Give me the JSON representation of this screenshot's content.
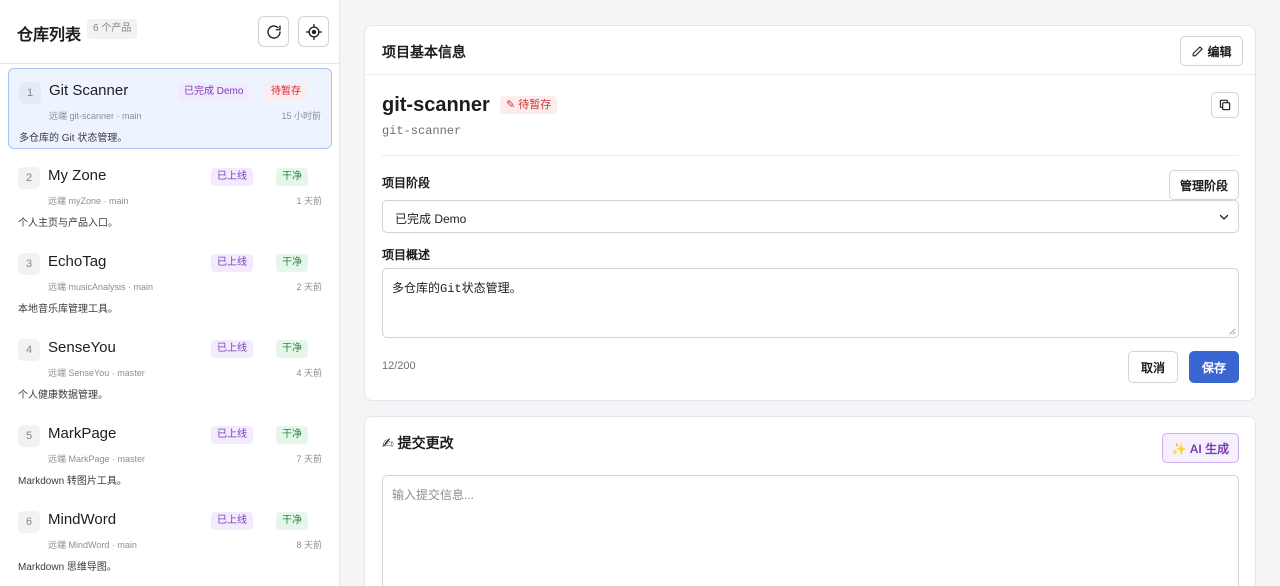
{
  "sidebar": {
    "title": "仓库列表",
    "count": "6 个产品",
    "repos": [
      {
        "index": "1",
        "name": "Git Scanner",
        "stage": "已完成 Demo",
        "status": "待暂存",
        "status_type": "pending",
        "meta": "远端 git-scanner ·   main",
        "time": "15 小时前",
        "desc": "多仓库的 Git 状态管理。",
        "active": true
      },
      {
        "index": "2",
        "name": "My Zone",
        "stage": "已上线",
        "status": "干净",
        "status_type": "clean",
        "meta": "远端 myZone ·   main",
        "time": "1 天前",
        "desc": "个人主页与产品入口。"
      },
      {
        "index": "3",
        "name": "EchoTag",
        "stage": "已上线",
        "status": "干净",
        "status_type": "clean",
        "meta": "远端 musicAnalysis ·   main",
        "time": "2 天前",
        "desc": "本地音乐库管理工具。"
      },
      {
        "index": "4",
        "name": "SenseYou",
        "stage": "已上线",
        "status": "干净",
        "status_type": "clean",
        "meta": "远端 SenseYou ·   master",
        "time": "4 天前",
        "desc": "个人健康数据管理。"
      },
      {
        "index": "5",
        "name": "MarkPage",
        "stage": "已上线",
        "status": "干净",
        "status_type": "clean",
        "meta": "远端 MarkPage ·   master",
        "time": "7 天前",
        "desc": "Markdown 转图片工具。"
      },
      {
        "index": "6",
        "name": "MindWord",
        "stage": "已上线",
        "status": "干净",
        "status_type": "clean",
        "meta": "远端 MindWord ·   main",
        "time": "8 天前",
        "desc": "Markdown 思维导图。"
      }
    ]
  },
  "project": {
    "section_title": "项目基本信息",
    "edit_label": "编辑",
    "name": "git-scanner",
    "badge": "✎ 待暂存",
    "path": "git-scanner",
    "stage_label": "项目阶段",
    "manage_stage_label": "管理阶段",
    "stage_value": "已完成 Demo",
    "desc_label": "项目概述",
    "desc_value": "多仓库的Git状态管理。",
    "char_count": "12/200",
    "cancel_label": "取消",
    "save_label": "保存"
  },
  "commit": {
    "title": "✍ 提交更改",
    "ai_label": "✨ AI 生成",
    "placeholder": "输入提交信息..."
  },
  "colors": {
    "accent": "#3a66d1",
    "stage_purple": "#7b3fb8",
    "clean_green": "#248a3d",
    "pending_red": "#d7263d"
  }
}
